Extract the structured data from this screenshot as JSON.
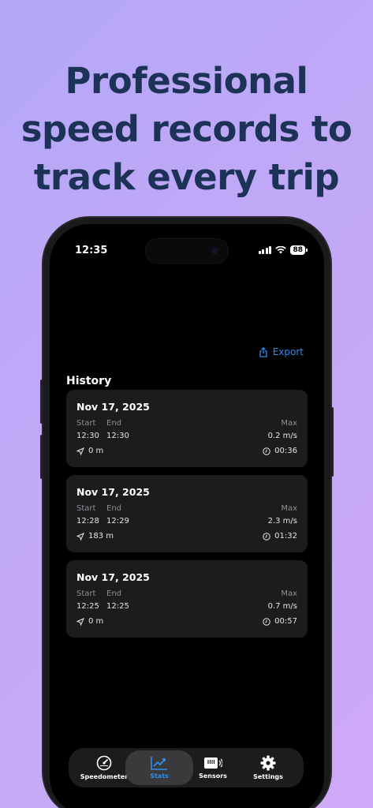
{
  "headline": [
    "Professional",
    "speed records to",
    "track every trip"
  ],
  "status": {
    "time": "12:35",
    "battery": "88"
  },
  "export_label": "Export",
  "history_title": "History",
  "labels": {
    "start": "Start",
    "end": "End",
    "max": "Max"
  },
  "trips": [
    {
      "date": "Nov 17, 2025",
      "start": "12:30",
      "end": "12:30",
      "max": "0.2 m/s",
      "distance": "0 m",
      "duration": "00:36"
    },
    {
      "date": "Nov 17, 2025",
      "start": "12:28",
      "end": "12:29",
      "max": "2.3 m/s",
      "distance": "183 m",
      "duration": "01:32"
    },
    {
      "date": "Nov 17, 2025",
      "start": "12:25",
      "end": "12:25",
      "max": "0.7 m/s",
      "distance": "0 m",
      "duration": "00:57"
    }
  ],
  "tabs": [
    {
      "label": "Speedometer",
      "icon": "speedometer-icon"
    },
    {
      "label": "Stats",
      "icon": "chart-icon",
      "active": true
    },
    {
      "label": "Sensors",
      "icon": "sensors-icon"
    },
    {
      "label": "Settings",
      "icon": "gear-icon"
    }
  ],
  "colors": {
    "accent": "#2d8cf0",
    "headline": "#1d3257",
    "card": "#1c1c1e"
  }
}
